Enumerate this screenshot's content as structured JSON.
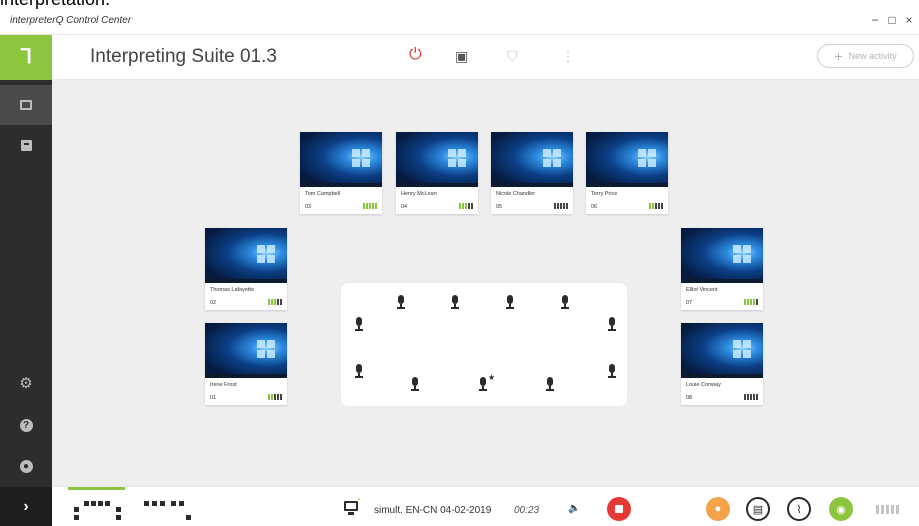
{
  "caption_fragment": "interpretation.",
  "window": {
    "title": "interpreterQ Control Center",
    "minimize": "−",
    "maximize": "□",
    "close": "×"
  },
  "header": {
    "title": "Interpreting Suite 01.3",
    "new_activity_label": "New activity",
    "new_activity_icon": "+"
  },
  "sidebar": {
    "logo": "ᒣ",
    "expand_glyph": "›",
    "icons": [
      "screen-icon",
      "archive-icon",
      "gear-icon",
      "help-icon",
      "user-icon"
    ]
  },
  "booths": [
    {
      "name": "Tom Campbell",
      "number": "03",
      "level": 5,
      "bars": 5
    },
    {
      "name": "Henry McLean",
      "number": "04",
      "level": 3,
      "bars": 5
    },
    {
      "name": "Nicole Chandler",
      "number": "05",
      "level": 0,
      "bars": 5
    },
    {
      "name": "Terry Price",
      "number": "06",
      "level": 2,
      "bars": 5
    },
    {
      "name": "Thomas Lafayette",
      "number": "02",
      "level": 3,
      "bars": 5
    },
    {
      "name": "Irene Frost",
      "number": "01",
      "level": 2,
      "bars": 5
    },
    {
      "name": "Elliot Vincent",
      "number": "07",
      "level": 4,
      "bars": 5
    },
    {
      "name": "Louie Conway",
      "number": "08",
      "level": 0,
      "bars": 5
    }
  ],
  "bottom": {
    "session_label": "simult. EN-CN 04-02-2019",
    "elapsed": "00:23",
    "meter_bars": 5
  },
  "colors": {
    "accent_green": "#8cc63f",
    "power_red": "#e53935",
    "orange": "#f5a34a",
    "sidebar": "#2d2d2d"
  }
}
